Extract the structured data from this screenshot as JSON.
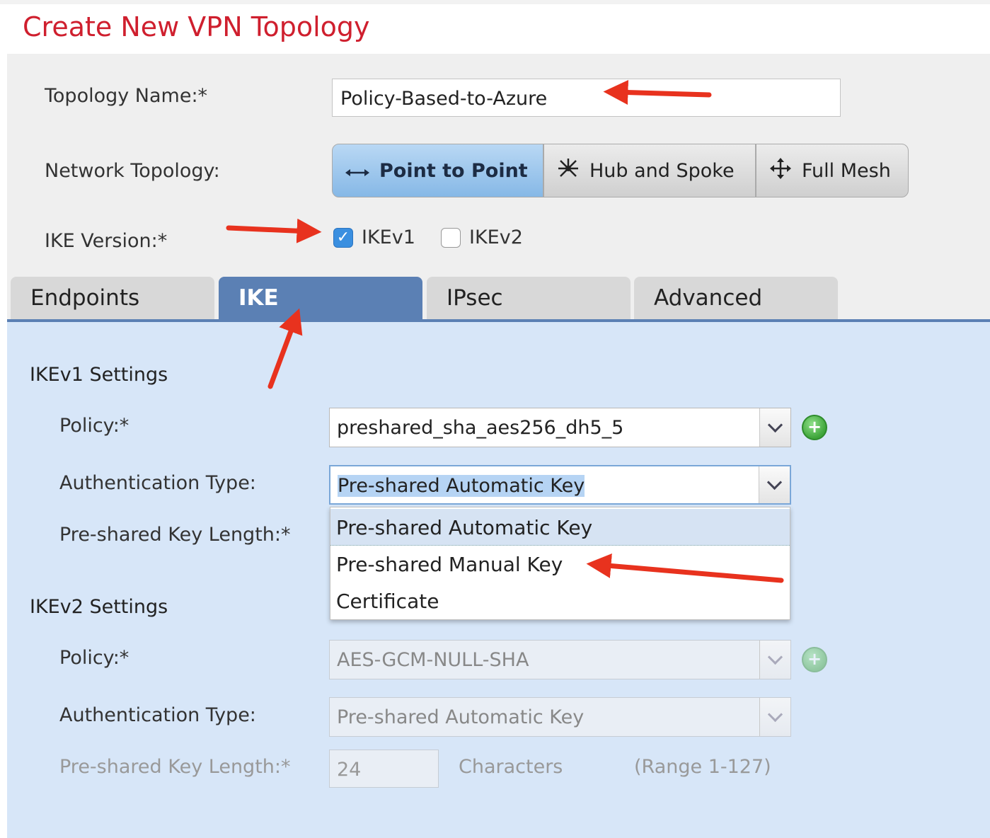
{
  "header": {
    "title": "Create New VPN Topology"
  },
  "form": {
    "topology_name_label": "Topology Name:*",
    "topology_name_value": "Policy-Based-to-Azure",
    "network_topology_label": "Network Topology:",
    "topology_options": [
      "Point to Point",
      "Hub and Spoke",
      "Full Mesh"
    ],
    "topology_selected": "Point to Point",
    "ike_version_label": "IKE Version:*",
    "ikev1_label": "IKEv1",
    "ikev1_checked": true,
    "ikev2_label": "IKEv2",
    "ikev2_checked": false
  },
  "tabs": [
    {
      "label": "Endpoints",
      "active": false
    },
    {
      "label": "IKE",
      "active": true
    },
    {
      "label": "IPsec",
      "active": false
    },
    {
      "label": "Advanced",
      "active": false
    }
  ],
  "ikev1": {
    "section_title": "IKEv1 Settings",
    "policy_label": "Policy:*",
    "policy_value": "preshared_sha_aes256_dh5_5",
    "auth_type_label": "Authentication Type:",
    "auth_type_value": "Pre-shared Automatic Key",
    "psk_length_label": "Pre-shared Key Length:*",
    "auth_options": [
      "Pre-shared Automatic Key",
      "Pre-shared Manual Key",
      "Certificate"
    ]
  },
  "ikev2": {
    "section_title": "IKEv2 Settings",
    "policy_label": "Policy:*",
    "policy_value": "AES-GCM-NULL-SHA",
    "auth_type_label": "Authentication Type:",
    "auth_type_value": "Pre-shared Automatic Key",
    "psk_length_label": "Pre-shared Key Length:*",
    "psk_length_value": "24",
    "characters_label": "Characters",
    "range_label": "(Range 1-127)"
  },
  "icons": {
    "point_to_point": "two-way-arrow-icon",
    "hub_and_spoke": "hub-spoke-icon",
    "full_mesh": "mesh-icon",
    "add": "plus-circle-icon",
    "dropdown": "chevron-down-icon",
    "check": "checkmark-icon"
  },
  "colors": {
    "title": "#cf1f2e",
    "active_tab": "#5b80b4",
    "content_bg": "#d7e6f8",
    "annotation_arrow": "#e8321e",
    "add_button": "#3ea53a"
  }
}
